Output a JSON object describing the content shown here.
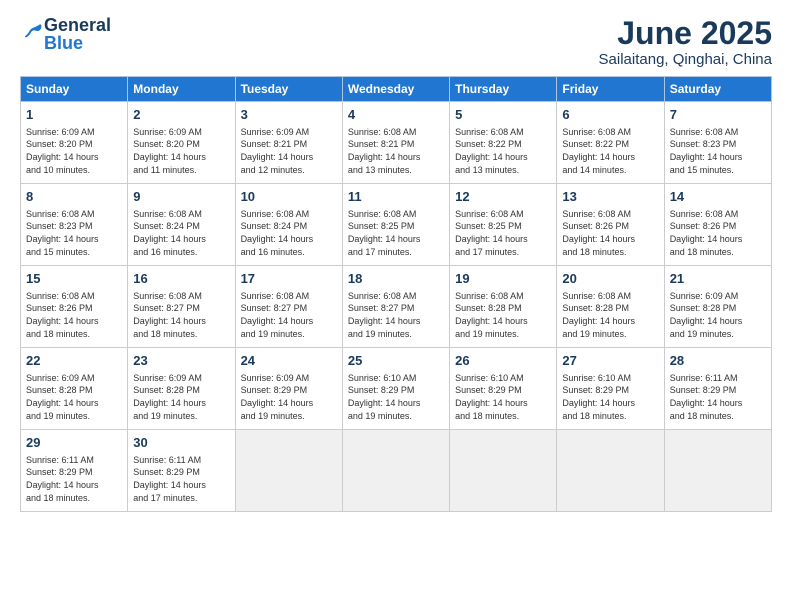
{
  "logo": {
    "general": "General",
    "blue": "Blue"
  },
  "header": {
    "month": "June 2025",
    "location": "Sailaitang, Qinghai, China"
  },
  "weekdays": [
    "Sunday",
    "Monday",
    "Tuesday",
    "Wednesday",
    "Thursday",
    "Friday",
    "Saturday"
  ],
  "weeks": [
    [
      {
        "day": "1",
        "info": "Sunrise: 6:09 AM\nSunset: 8:20 PM\nDaylight: 14 hours\nand 10 minutes."
      },
      {
        "day": "2",
        "info": "Sunrise: 6:09 AM\nSunset: 8:20 PM\nDaylight: 14 hours\nand 11 minutes."
      },
      {
        "day": "3",
        "info": "Sunrise: 6:09 AM\nSunset: 8:21 PM\nDaylight: 14 hours\nand 12 minutes."
      },
      {
        "day": "4",
        "info": "Sunrise: 6:08 AM\nSunset: 8:21 PM\nDaylight: 14 hours\nand 13 minutes."
      },
      {
        "day": "5",
        "info": "Sunrise: 6:08 AM\nSunset: 8:22 PM\nDaylight: 14 hours\nand 13 minutes."
      },
      {
        "day": "6",
        "info": "Sunrise: 6:08 AM\nSunset: 8:22 PM\nDaylight: 14 hours\nand 14 minutes."
      },
      {
        "day": "7",
        "info": "Sunrise: 6:08 AM\nSunset: 8:23 PM\nDaylight: 14 hours\nand 15 minutes."
      }
    ],
    [
      {
        "day": "8",
        "info": "Sunrise: 6:08 AM\nSunset: 8:23 PM\nDaylight: 14 hours\nand 15 minutes."
      },
      {
        "day": "9",
        "info": "Sunrise: 6:08 AM\nSunset: 8:24 PM\nDaylight: 14 hours\nand 16 minutes."
      },
      {
        "day": "10",
        "info": "Sunrise: 6:08 AM\nSunset: 8:24 PM\nDaylight: 14 hours\nand 16 minutes."
      },
      {
        "day": "11",
        "info": "Sunrise: 6:08 AM\nSunset: 8:25 PM\nDaylight: 14 hours\nand 17 minutes."
      },
      {
        "day": "12",
        "info": "Sunrise: 6:08 AM\nSunset: 8:25 PM\nDaylight: 14 hours\nand 17 minutes."
      },
      {
        "day": "13",
        "info": "Sunrise: 6:08 AM\nSunset: 8:26 PM\nDaylight: 14 hours\nand 18 minutes."
      },
      {
        "day": "14",
        "info": "Sunrise: 6:08 AM\nSunset: 8:26 PM\nDaylight: 14 hours\nand 18 minutes."
      }
    ],
    [
      {
        "day": "15",
        "info": "Sunrise: 6:08 AM\nSunset: 8:26 PM\nDaylight: 14 hours\nand 18 minutes."
      },
      {
        "day": "16",
        "info": "Sunrise: 6:08 AM\nSunset: 8:27 PM\nDaylight: 14 hours\nand 18 minutes."
      },
      {
        "day": "17",
        "info": "Sunrise: 6:08 AM\nSunset: 8:27 PM\nDaylight: 14 hours\nand 19 minutes."
      },
      {
        "day": "18",
        "info": "Sunrise: 6:08 AM\nSunset: 8:27 PM\nDaylight: 14 hours\nand 19 minutes."
      },
      {
        "day": "19",
        "info": "Sunrise: 6:08 AM\nSunset: 8:28 PM\nDaylight: 14 hours\nand 19 minutes."
      },
      {
        "day": "20",
        "info": "Sunrise: 6:08 AM\nSunset: 8:28 PM\nDaylight: 14 hours\nand 19 minutes."
      },
      {
        "day": "21",
        "info": "Sunrise: 6:09 AM\nSunset: 8:28 PM\nDaylight: 14 hours\nand 19 minutes."
      }
    ],
    [
      {
        "day": "22",
        "info": "Sunrise: 6:09 AM\nSunset: 8:28 PM\nDaylight: 14 hours\nand 19 minutes."
      },
      {
        "day": "23",
        "info": "Sunrise: 6:09 AM\nSunset: 8:28 PM\nDaylight: 14 hours\nand 19 minutes."
      },
      {
        "day": "24",
        "info": "Sunrise: 6:09 AM\nSunset: 8:29 PM\nDaylight: 14 hours\nand 19 minutes."
      },
      {
        "day": "25",
        "info": "Sunrise: 6:10 AM\nSunset: 8:29 PM\nDaylight: 14 hours\nand 19 minutes."
      },
      {
        "day": "26",
        "info": "Sunrise: 6:10 AM\nSunset: 8:29 PM\nDaylight: 14 hours\nand 18 minutes."
      },
      {
        "day": "27",
        "info": "Sunrise: 6:10 AM\nSunset: 8:29 PM\nDaylight: 14 hours\nand 18 minutes."
      },
      {
        "day": "28",
        "info": "Sunrise: 6:11 AM\nSunset: 8:29 PM\nDaylight: 14 hours\nand 18 minutes."
      }
    ],
    [
      {
        "day": "29",
        "info": "Sunrise: 6:11 AM\nSunset: 8:29 PM\nDaylight: 14 hours\nand 18 minutes."
      },
      {
        "day": "30",
        "info": "Sunrise: 6:11 AM\nSunset: 8:29 PM\nDaylight: 14 hours\nand 17 minutes."
      },
      {
        "day": "",
        "info": ""
      },
      {
        "day": "",
        "info": ""
      },
      {
        "day": "",
        "info": ""
      },
      {
        "day": "",
        "info": ""
      },
      {
        "day": "",
        "info": ""
      }
    ]
  ]
}
